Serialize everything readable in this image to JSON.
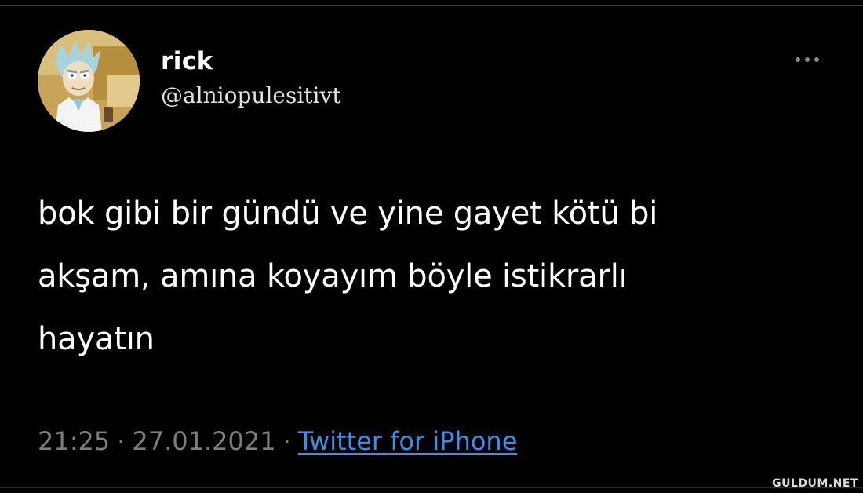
{
  "tweet": {
    "display_name": "rick",
    "handle": "@alniopulesitivt",
    "text": "bok gibi bir gündü ve yine gayet kötü bi\nakşam, amına koyayım böyle istikrarlı\nhayatın",
    "time": "21:25",
    "date": "27.01.2021",
    "separator": "·",
    "source": "Twitter for iPhone",
    "more_icon": "more-horizontal-icon",
    "avatar_icon": "profile-avatar-icon"
  },
  "watermark": {
    "text": "GULDUM.NET"
  },
  "colors": {
    "background": "#000000",
    "text": "#ffffff",
    "meta": "#7e7e7e",
    "link": "#3d8ee8"
  }
}
